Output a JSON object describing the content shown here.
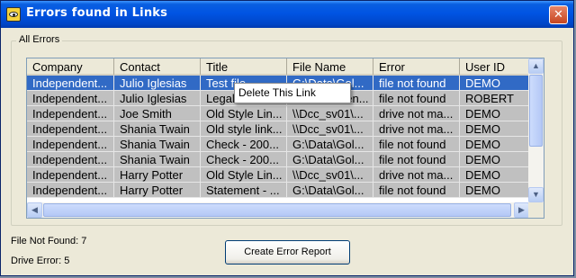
{
  "window": {
    "title": "Errors found in Links",
    "close_label": "✕"
  },
  "group": {
    "label": "All Errors"
  },
  "table": {
    "columns": [
      "Company",
      "Contact",
      "Title",
      "File Name",
      "Error",
      "User ID"
    ],
    "rows": [
      [
        "Independent...",
        "Julio Iglesias",
        "Test file",
        "G:\\Data\\Gol...",
        "file not found",
        "DEMO"
      ],
      [
        "Independent...",
        "Julio Iglesias",
        "Legal D...",
        "G:\\Data\\...en...",
        "file not found",
        "ROBERT"
      ],
      [
        "Independent...",
        "Joe Smith",
        "Old Style Lin...",
        "\\\\Dcc_sv01\\...",
        "drive not ma...",
        "DEMO"
      ],
      [
        "Independent...",
        "Shania Twain",
        "Old style link...",
        "\\\\Dcc_sv01\\...",
        "drive not ma...",
        "DEMO"
      ],
      [
        "Independent...",
        "Shania Twain",
        "Check - 200...",
        "G:\\Data\\Gol...",
        "file not found",
        "DEMO"
      ],
      [
        "Independent...",
        "Shania Twain",
        "Check - 200...",
        "G:\\Data\\Gol...",
        "file not found",
        "DEMO"
      ],
      [
        "Independent...",
        "Harry Potter",
        "Old Style Lin...",
        "\\\\Dcc_sv01\\...",
        "drive not ma...",
        "DEMO"
      ],
      [
        "Independent...",
        "Harry Potter",
        "Statement - ...",
        "G:\\Data\\Gol...",
        "file not found",
        "DEMO"
      ]
    ],
    "selected_row": 0
  },
  "context_menu": {
    "items": [
      "Delete This Link"
    ]
  },
  "status": {
    "file_not_found": "File Not Found: 7",
    "drive_error": "Drive Error: 5"
  },
  "buttons": {
    "create_report": "Create Error Report"
  },
  "icons": {
    "app_icon": "eye-icon",
    "close_icon": "close-icon",
    "scroll_up": "arrow-up-icon",
    "scroll_down": "arrow-down-icon",
    "scroll_left": "arrow-left-icon",
    "scroll_right": "arrow-right-icon"
  },
  "colors": {
    "selection": "#316ac5",
    "titlebar": "#0054e3",
    "row_bg": "#c0c0c0"
  }
}
